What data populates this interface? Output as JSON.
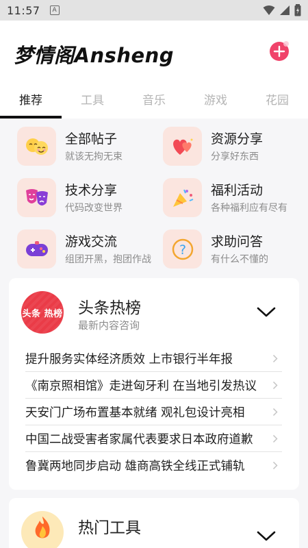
{
  "status_bar": {
    "time": "11:57",
    "a_badge": "A"
  },
  "header": {
    "app_title": "梦情阁Ansheng"
  },
  "tabs": [
    {
      "label": "推荐",
      "active": true
    },
    {
      "label": "工具",
      "active": false
    },
    {
      "label": "音乐",
      "active": false
    },
    {
      "label": "游戏",
      "active": false
    },
    {
      "label": "花园",
      "active": false
    }
  ],
  "categories": [
    {
      "name": "全部帖子",
      "desc": "就该无拘无束",
      "icon": "emoji-faces-icon"
    },
    {
      "name": "资源分享",
      "desc": "分享好东西",
      "icon": "hearts-icon"
    },
    {
      "name": "技术分享",
      "desc": "代码改变世界",
      "icon": "theater-masks-icon"
    },
    {
      "name": "福利活动",
      "desc": "各种福利应有尽有",
      "icon": "party-popper-icon"
    },
    {
      "name": "游戏交流",
      "desc": "组团开黑，抱团作战",
      "icon": "gamepad-icon"
    },
    {
      "name": "求助问答",
      "desc": "有什么不懂的",
      "icon": "question-icon"
    }
  ],
  "hot_card": {
    "badge_text": "头条 热榜",
    "title": "头条热榜",
    "subtitle": "最新内容咨询",
    "news": [
      "提升服务实体经济质效 上市银行半年报",
      "《南京照相馆》走进匈牙利 在当地引发热议",
      "天安门广场布置基本就绪 观礼包设计亮相",
      "中国二战受害者家属代表要求日本政府道歉",
      "鲁冀两地同步启动 雄商高铁全线正式铺轨"
    ]
  },
  "tools_card": {
    "title": "热门工具"
  },
  "colors": {
    "accent": "#f0436a",
    "hot_red": "#ea3b47",
    "icon_bg": "#fbe5df"
  }
}
